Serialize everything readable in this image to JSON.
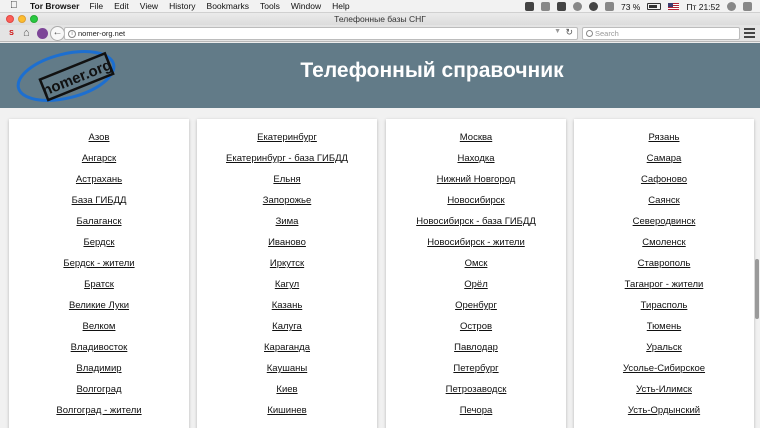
{
  "menubar": {
    "app_name": "Tor Browser",
    "items": [
      "File",
      "Edit",
      "View",
      "History",
      "Bookmarks",
      "Tools",
      "Window",
      "Help"
    ],
    "battery": "73 %",
    "clock": "Пт 21:52"
  },
  "window": {
    "title": "Телефонные базы СНГ"
  },
  "toolbar": {
    "url": "nomer-org.net",
    "search_placeholder": "Search"
  },
  "page": {
    "logo_text": "nomer.org",
    "title": "Телефонный справочник",
    "columns": [
      [
        "Азов",
        "Ангарск",
        "Астрахань",
        "База ГИБДД",
        "Балаганск",
        "Бердск",
        "Бердск - жители",
        "Братск",
        "Великие Луки",
        "Велком",
        "Владивосток",
        "Владимир",
        "Волгоград",
        "Волгоград - жители"
      ],
      [
        "Екатеринбург",
        "Екатеринбург - база ГИБДД",
        "Ельня",
        "Запорожье",
        "Зима",
        "Иваново",
        "Иркутск",
        "Кагул",
        "Казань",
        "Калуга",
        "Караганда",
        "Каушаны",
        "Киев",
        "Кишинев"
      ],
      [
        "Москва",
        "Находка",
        "Нижний Новгород",
        "Новосибирск",
        "Новосибирск - база ГИБДД",
        "Новосибирск - жители",
        "Омск",
        "Орёл",
        "Оренбург",
        "Остров",
        "Павлодар",
        "Петербург",
        "Петрозаводск",
        "Печора"
      ],
      [
        "Рязань",
        "Самара",
        "Сафоново",
        "Саянск",
        "Северодвинск",
        "Смоленск",
        "Ставрополь",
        "Таганрог - жители",
        "Тирасполь",
        "Тюмень",
        "Уральск",
        "Усолье-Сибирское",
        "Усть-Илимск",
        "Усть-Ордынский"
      ]
    ]
  }
}
